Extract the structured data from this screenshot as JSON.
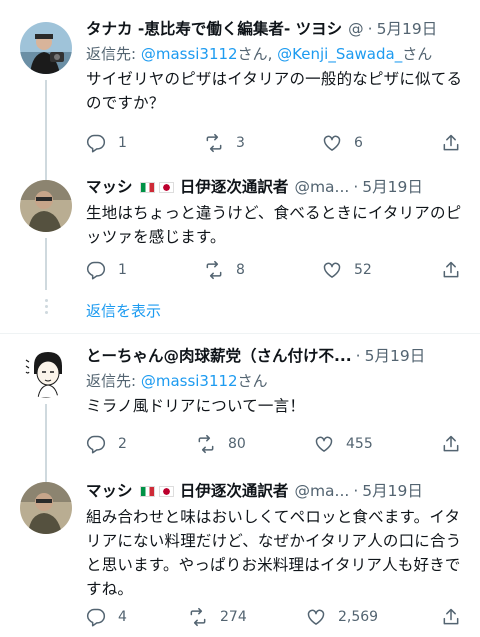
{
  "tweets": [
    {
      "name": "タナカ -恵比寿で働く編集者- ツヨシ",
      "handle": "@",
      "dot": "·",
      "date": "5月19日",
      "reply_prefix": "返信先: ",
      "reply_users": [
        "@massi3112",
        "@Kenji_Sawada_"
      ],
      "reply_suffix": "さん",
      "reply_sep": "さん, ",
      "text": "サイゼリヤのピザはイタリアの一般的なピザに似てるのですか？",
      "replies": "1",
      "retweets": "3",
      "likes": "6"
    },
    {
      "name": "マッシ",
      "name_suffix": "日伊逐次通訳者",
      "handle": "@ma...",
      "dot": "·",
      "date": "5月19日",
      "text": "生地はちょっと違うけど、食べるときにイタリアのピッツァを感じます。",
      "replies": "1",
      "retweets": "8",
      "likes": "52"
    },
    {
      "name": "とーちゃん@肉球薪党（さん付け不...",
      "dot": "·",
      "date": "5月19日",
      "reply_prefix": "返信先: ",
      "reply_users": [
        "@massi3112"
      ],
      "reply_suffix": "さん",
      "text": "ミラノ風ドリアについて一言！",
      "replies": "2",
      "retweets": "80",
      "likes": "455"
    },
    {
      "name": "マッシ",
      "name_suffix": "日伊逐次通訳者",
      "handle": "@ma...",
      "dot": "·",
      "date": "5月19日",
      "text": "組み合わせと味はおいしくてペロッと食べます。イタリアにない料理だけど、なぜかイタリア人の口に合うと思います。やっぱりお米料理はイタリア人も好きですね。",
      "replies": "4",
      "retweets": "274",
      "likes": "2,569"
    }
  ],
  "show_replies_label": "返信を表示",
  "colors": {
    "link": "#1d9bf0",
    "muted": "#536471",
    "text": "#0f1419",
    "thread_line": "#cfd9de",
    "separator": "#eff3f4"
  },
  "icons": [
    "reply-icon",
    "retweet-icon",
    "like-icon",
    "share-icon",
    "italy-flag-icon",
    "japan-flag-icon"
  ]
}
